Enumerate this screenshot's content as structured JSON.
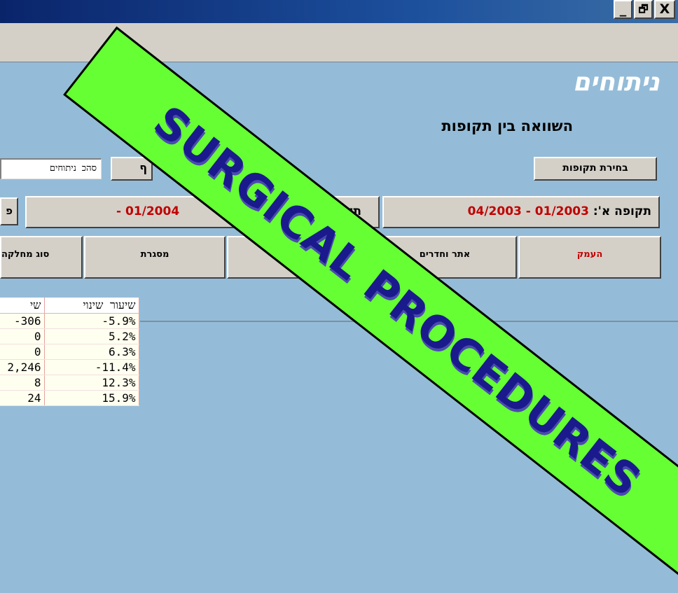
{
  "window": {
    "minimize_glyph": "_",
    "restore_glyph": "🗗",
    "close_glyph": "X"
  },
  "header": {
    "app_title": "ניתוחים",
    "subtitle": "השוואה בין תקופות"
  },
  "controls": {
    "select_periods_label": "בחירת תקופות",
    "filter_field_value": "סהכ ניתוחים",
    "filter_button_partial": "ף"
  },
  "periods": {
    "period_a_label": "תקופה א':",
    "period_a_value": "01/2003 - 04/2003",
    "period_b_label_partial": "תק",
    "period_b_value_partial": "01/2004 -",
    "right_edge_partial": "פ"
  },
  "tabs": [
    {
      "label": "העמק",
      "color": "#c00000"
    },
    {
      "label": "אתר וחדרים",
      "color": "#000000"
    },
    {
      "label": "",
      "color": "#000000"
    },
    {
      "label": "מסגרת",
      "color": "#000000"
    },
    {
      "label": "סוג מחלקה",
      "color": "#000000"
    }
  ],
  "grid": {
    "headers": [
      "שי",
      "שיעור שינוי"
    ],
    "rows": [
      [
        "-306",
        "-5.9%"
      ],
      [
        "0",
        "5.2%"
      ],
      [
        "0",
        "6.3%"
      ],
      [
        "2,246",
        "-11.4%"
      ],
      [
        "8",
        "12.3%"
      ],
      [
        "24",
        "15.9%"
      ]
    ]
  },
  "banner": {
    "text": "SURGICAL PROCEDURES",
    "fill_color": "#66ff33",
    "text_color": "#1a1a8c"
  }
}
